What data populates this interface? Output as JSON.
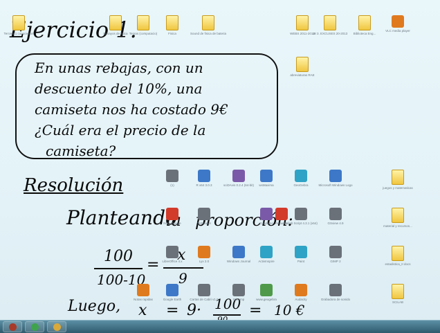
{
  "whiteboard": {
    "title": "Ejercicio 1.",
    "problem_lines": [
      "En unas rebajas, con un",
      "descuento del 10%, una",
      "camiseta nos ha costado 9€",
      "¿Cuál era el precio de la",
      "camiseta?"
    ],
    "heading": "Resolución",
    "planteando": "Planteando",
    "la": "la",
    "proporcion": "proporción:",
    "frac1_num": "100",
    "frac1_den": "100-10",
    "equals": "=",
    "frac2_num": "x",
    "frac2_den": "9",
    "luego": "Luego,",
    "luego_x": "x",
    "luego_eq": "=",
    "luego_9": "9·",
    "luego_num": "100",
    "luego_den": "90",
    "luego_eq2": "=",
    "result": "10 €"
  },
  "desktop_icons": [
    {
      "name": "folder-icon",
      "label": "Tercero 1 conocemos",
      "type": "folder"
    },
    {
      "name": "folder-icon",
      "label": "Ensayos de fisica",
      "type": "folder"
    },
    {
      "name": "folder-icon",
      "label": "Temas (computacio)",
      "type": "folder"
    },
    {
      "name": "folder-icon",
      "label": "Fisica",
      "type": "folder"
    },
    {
      "name": "folder-icon",
      "label": "Sound de fisica de bateria",
      "type": "folder"
    },
    {
      "name": "folder-icon",
      "label": "WEBS 2011-2014",
      "type": "folder"
    },
    {
      "name": "folder-icon",
      "label": "18 3. EXCUSES 20-2013",
      "type": "folder"
    },
    {
      "name": "folder-icon",
      "label": "Biblioteca Eng...",
      "type": "folder"
    },
    {
      "name": "folder-icon",
      "label": "VLC media player",
      "type": "vlc"
    },
    {
      "name": "folder-icon",
      "label": "abreviaturas RAE",
      "type": "folder"
    },
    {
      "name": "app-icon",
      "label": "(1)",
      "type": "gray"
    },
    {
      "name": "app-icon",
      "label": "R x64 3.0.3",
      "type": "blue"
    },
    {
      "name": "app-icon",
      "label": "sciDAvis 0.2.4 (64-bit)",
      "type": "app"
    },
    {
      "name": "app-icon",
      "label": "wxMaxima",
      "type": "blue"
    },
    {
      "name": "app-icon",
      "label": "GeoGebra",
      "type": "cyan"
    },
    {
      "name": "app-icon",
      "label": "Microsoft Windows Logo",
      "type": "blue"
    },
    {
      "name": "folder-icon",
      "label": "juegos y matematicas",
      "type": "folder"
    },
    {
      "name": "app-icon",
      "label": "Nota Google",
      "type": "red"
    },
    {
      "name": "app-icon",
      "label": "TeXmaker",
      "type": "gray"
    },
    {
      "name": "app-icon",
      "label": "Cuaderno",
      "type": "app"
    },
    {
      "name": "app-icon",
      "label": "Firmware",
      "type": "red"
    },
    {
      "name": "app-icon",
      "label": "Scilab Script 4.3.1 (x64)",
      "type": "gray"
    },
    {
      "name": "app-icon",
      "label": "GSview 4.9",
      "type": "gray"
    },
    {
      "name": "folder-icon",
      "label": "material y recursos...",
      "type": "folder"
    },
    {
      "name": "app-icon",
      "label": "LibreOffice 4.x",
      "type": "gray"
    },
    {
      "name": "app-icon",
      "label": "Lyx 2.0",
      "type": "orange"
    },
    {
      "name": "app-icon",
      "label": "Windows Journal",
      "type": "blue"
    },
    {
      "name": "app-icon",
      "label": "ActivInspire",
      "type": "cyan"
    },
    {
      "name": "app-icon",
      "label": "Paint",
      "type": "cyan"
    },
    {
      "name": "app-icon",
      "label": "GIMP 2",
      "type": "gray"
    },
    {
      "name": "folder-icon",
      "label": "estadistica_II docs",
      "type": "folder"
    },
    {
      "name": "app-icon",
      "label": "Notas rapidas",
      "type": "orange"
    },
    {
      "name": "app-icon",
      "label": "Google Earth",
      "type": "blue"
    },
    {
      "name": "app-icon",
      "label": "Cartas de Cabri v1.0",
      "type": "gray"
    },
    {
      "name": "app-icon",
      "label": "Winamp",
      "type": "gray"
    },
    {
      "name": "app-icon",
      "label": "www.geogebra",
      "type": "green"
    },
    {
      "name": "app-icon",
      "label": "Audacity",
      "type": "orange"
    },
    {
      "name": "app-icon",
      "label": "Grabadora de sonido",
      "type": "gray"
    },
    {
      "name": "folder-icon",
      "label": "SCILAB",
      "type": "folder"
    }
  ],
  "taskbar": {
    "buttons": [
      {
        "name": "ink-app-button",
        "color": "#a83a2a"
      },
      {
        "name": "chrome-button",
        "color": "#3fa34d"
      },
      {
        "name": "explorer-button",
        "color": "#d9a93a"
      }
    ]
  }
}
